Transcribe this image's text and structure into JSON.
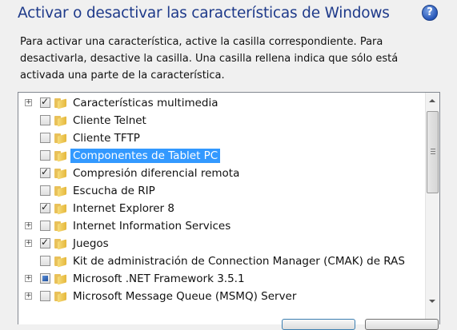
{
  "dialog": {
    "title": "Activar o desactivar las características de Windows",
    "description": "Para activar una característica, active la casilla correspondiente. Para desactivarla, desactive la casilla. Una casilla rellena indica que sólo está activada una parte de la característica.",
    "help_icon": "question-mark-icon",
    "accent_color": "#1e3a8a",
    "selection_color": "#3399ff"
  },
  "features": [
    {
      "label": "Características multimedia",
      "state": "checked",
      "expandable": true,
      "selected": false
    },
    {
      "label": "Cliente Telnet",
      "state": "unchecked",
      "expandable": false,
      "selected": false
    },
    {
      "label": "Cliente TFTP",
      "state": "unchecked",
      "expandable": false,
      "selected": false
    },
    {
      "label": "Componentes de Tablet PC",
      "state": "unchecked",
      "expandable": false,
      "selected": true
    },
    {
      "label": "Compresión diferencial remota",
      "state": "checked",
      "expandable": false,
      "selected": false
    },
    {
      "label": "Escucha de RIP",
      "state": "unchecked",
      "expandable": false,
      "selected": false
    },
    {
      "label": "Internet Explorer 8",
      "state": "checked",
      "expandable": false,
      "selected": false
    },
    {
      "label": "Internet Information Services",
      "state": "unchecked",
      "expandable": true,
      "selected": false
    },
    {
      "label": "Juegos",
      "state": "checked",
      "expandable": true,
      "selected": false
    },
    {
      "label": "Kit de administración de Connection Manager (CMAK) de RAS",
      "state": "unchecked",
      "expandable": false,
      "selected": false
    },
    {
      "label": "Microsoft .NET Framework 3.5.1",
      "state": "partial",
      "expandable": true,
      "selected": false
    },
    {
      "label": "Microsoft Message Queue (MSMQ) Server",
      "state": "unchecked",
      "expandable": true,
      "selected": false
    }
  ]
}
